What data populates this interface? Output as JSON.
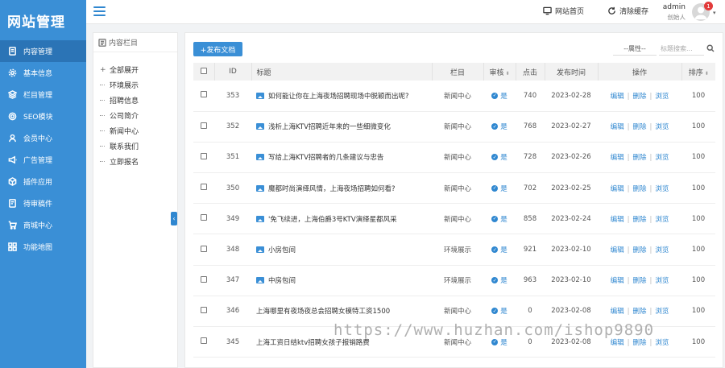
{
  "app": {
    "title": "网站管理"
  },
  "sidebar": {
    "items": [
      {
        "label": "内容管理",
        "icon": "document-icon",
        "active": true
      },
      {
        "label": "基本信息",
        "icon": "gear-icon",
        "active": false
      },
      {
        "label": "栏目管理",
        "icon": "layers-icon",
        "active": false
      },
      {
        "label": "SEO模块",
        "icon": "target-icon",
        "active": false
      },
      {
        "label": "会员中心",
        "icon": "user-icon",
        "active": false
      },
      {
        "label": "广告管理",
        "icon": "megaphone-icon",
        "active": false
      },
      {
        "label": "插件应用",
        "icon": "cube-icon",
        "active": false
      },
      {
        "label": "待审稿件",
        "icon": "pending-doc-icon",
        "active": false
      },
      {
        "label": "商城中心",
        "icon": "cart-icon",
        "active": false
      },
      {
        "label": "功能地图",
        "icon": "grid-icon",
        "active": false
      }
    ]
  },
  "header": {
    "home_label": "网站首页",
    "clear_cache_label": "清除缓存",
    "user_name": "admin",
    "user_role": "创始人",
    "notification_count": "1"
  },
  "tree": {
    "title": "内容栏目",
    "root_label": "全部展开",
    "items": [
      "环境展示",
      "招聘信息",
      "公司简介",
      "新闻中心",
      "联系我们",
      "立即报名"
    ]
  },
  "toolbar": {
    "add_label": "+发布文档",
    "attr_select": "--属性--",
    "search_placeholder": "标题搜索..."
  },
  "table": {
    "headers": [
      "ID",
      "标题",
      "栏目",
      "审核",
      "点击",
      "发布时间",
      "操作",
      "排序"
    ],
    "op_labels": [
      "编辑",
      "删除",
      "浏览"
    ],
    "rows": [
      {
        "id": "353",
        "title": "如何能让你在上海夜场招聘现场中脱颖而出呢?",
        "column": "新闻中心",
        "audit": "是",
        "clicks": "740",
        "date": "2023-02-28",
        "sort": "100",
        "has_image": true
      },
      {
        "id": "352",
        "title": "浅析上海KTV招聘近年来的一些细微变化",
        "column": "新闻中心",
        "audit": "是",
        "clicks": "768",
        "date": "2023-02-27",
        "sort": "100",
        "has_image": true
      },
      {
        "id": "351",
        "title": "写给上海KTV招聘者的几条建议与忠告",
        "column": "新闻中心",
        "audit": "是",
        "clicks": "728",
        "date": "2023-02-26",
        "sort": "100",
        "has_image": true
      },
      {
        "id": "350",
        "title": "魔都时尚演绎风情，上海夜场招聘如何看?",
        "column": "新闻中心",
        "audit": "是",
        "clicks": "702",
        "date": "2023-02-25",
        "sort": "100",
        "has_image": true
      },
      {
        "id": "349",
        "title": "'免飞续进，上海伯爵3号KTV演绎星都风采",
        "column": "新闻中心",
        "audit": "是",
        "clicks": "858",
        "date": "2023-02-24",
        "sort": "100",
        "has_image": true
      },
      {
        "id": "348",
        "title": "小房包间",
        "column": "环境展示",
        "audit": "是",
        "clicks": "921",
        "date": "2023-02-10",
        "sort": "100",
        "has_image": true
      },
      {
        "id": "347",
        "title": "中房包间",
        "column": "环境展示",
        "audit": "是",
        "clicks": "963",
        "date": "2023-02-10",
        "sort": "100",
        "has_image": true
      },
      {
        "id": "346",
        "title": "上海哪里有夜场夜总会招聘女模特工资1500",
        "column": "新闻中心",
        "audit": "是",
        "clicks": "0",
        "date": "2023-02-08",
        "sort": "100",
        "has_image": false
      },
      {
        "id": "345",
        "title": "上海工资日结ktv招聘女孩子报销路费",
        "column": "新闻中心",
        "audit": "是",
        "clicks": "0",
        "date": "2023-02-08",
        "sort": "100",
        "has_image": false
      }
    ]
  },
  "watermark": "https://www.huzhan.com/ishop9890",
  "colors": {
    "primary": "#3a8fd6",
    "active": "#2b74b6",
    "badge": "#e23b3b"
  }
}
